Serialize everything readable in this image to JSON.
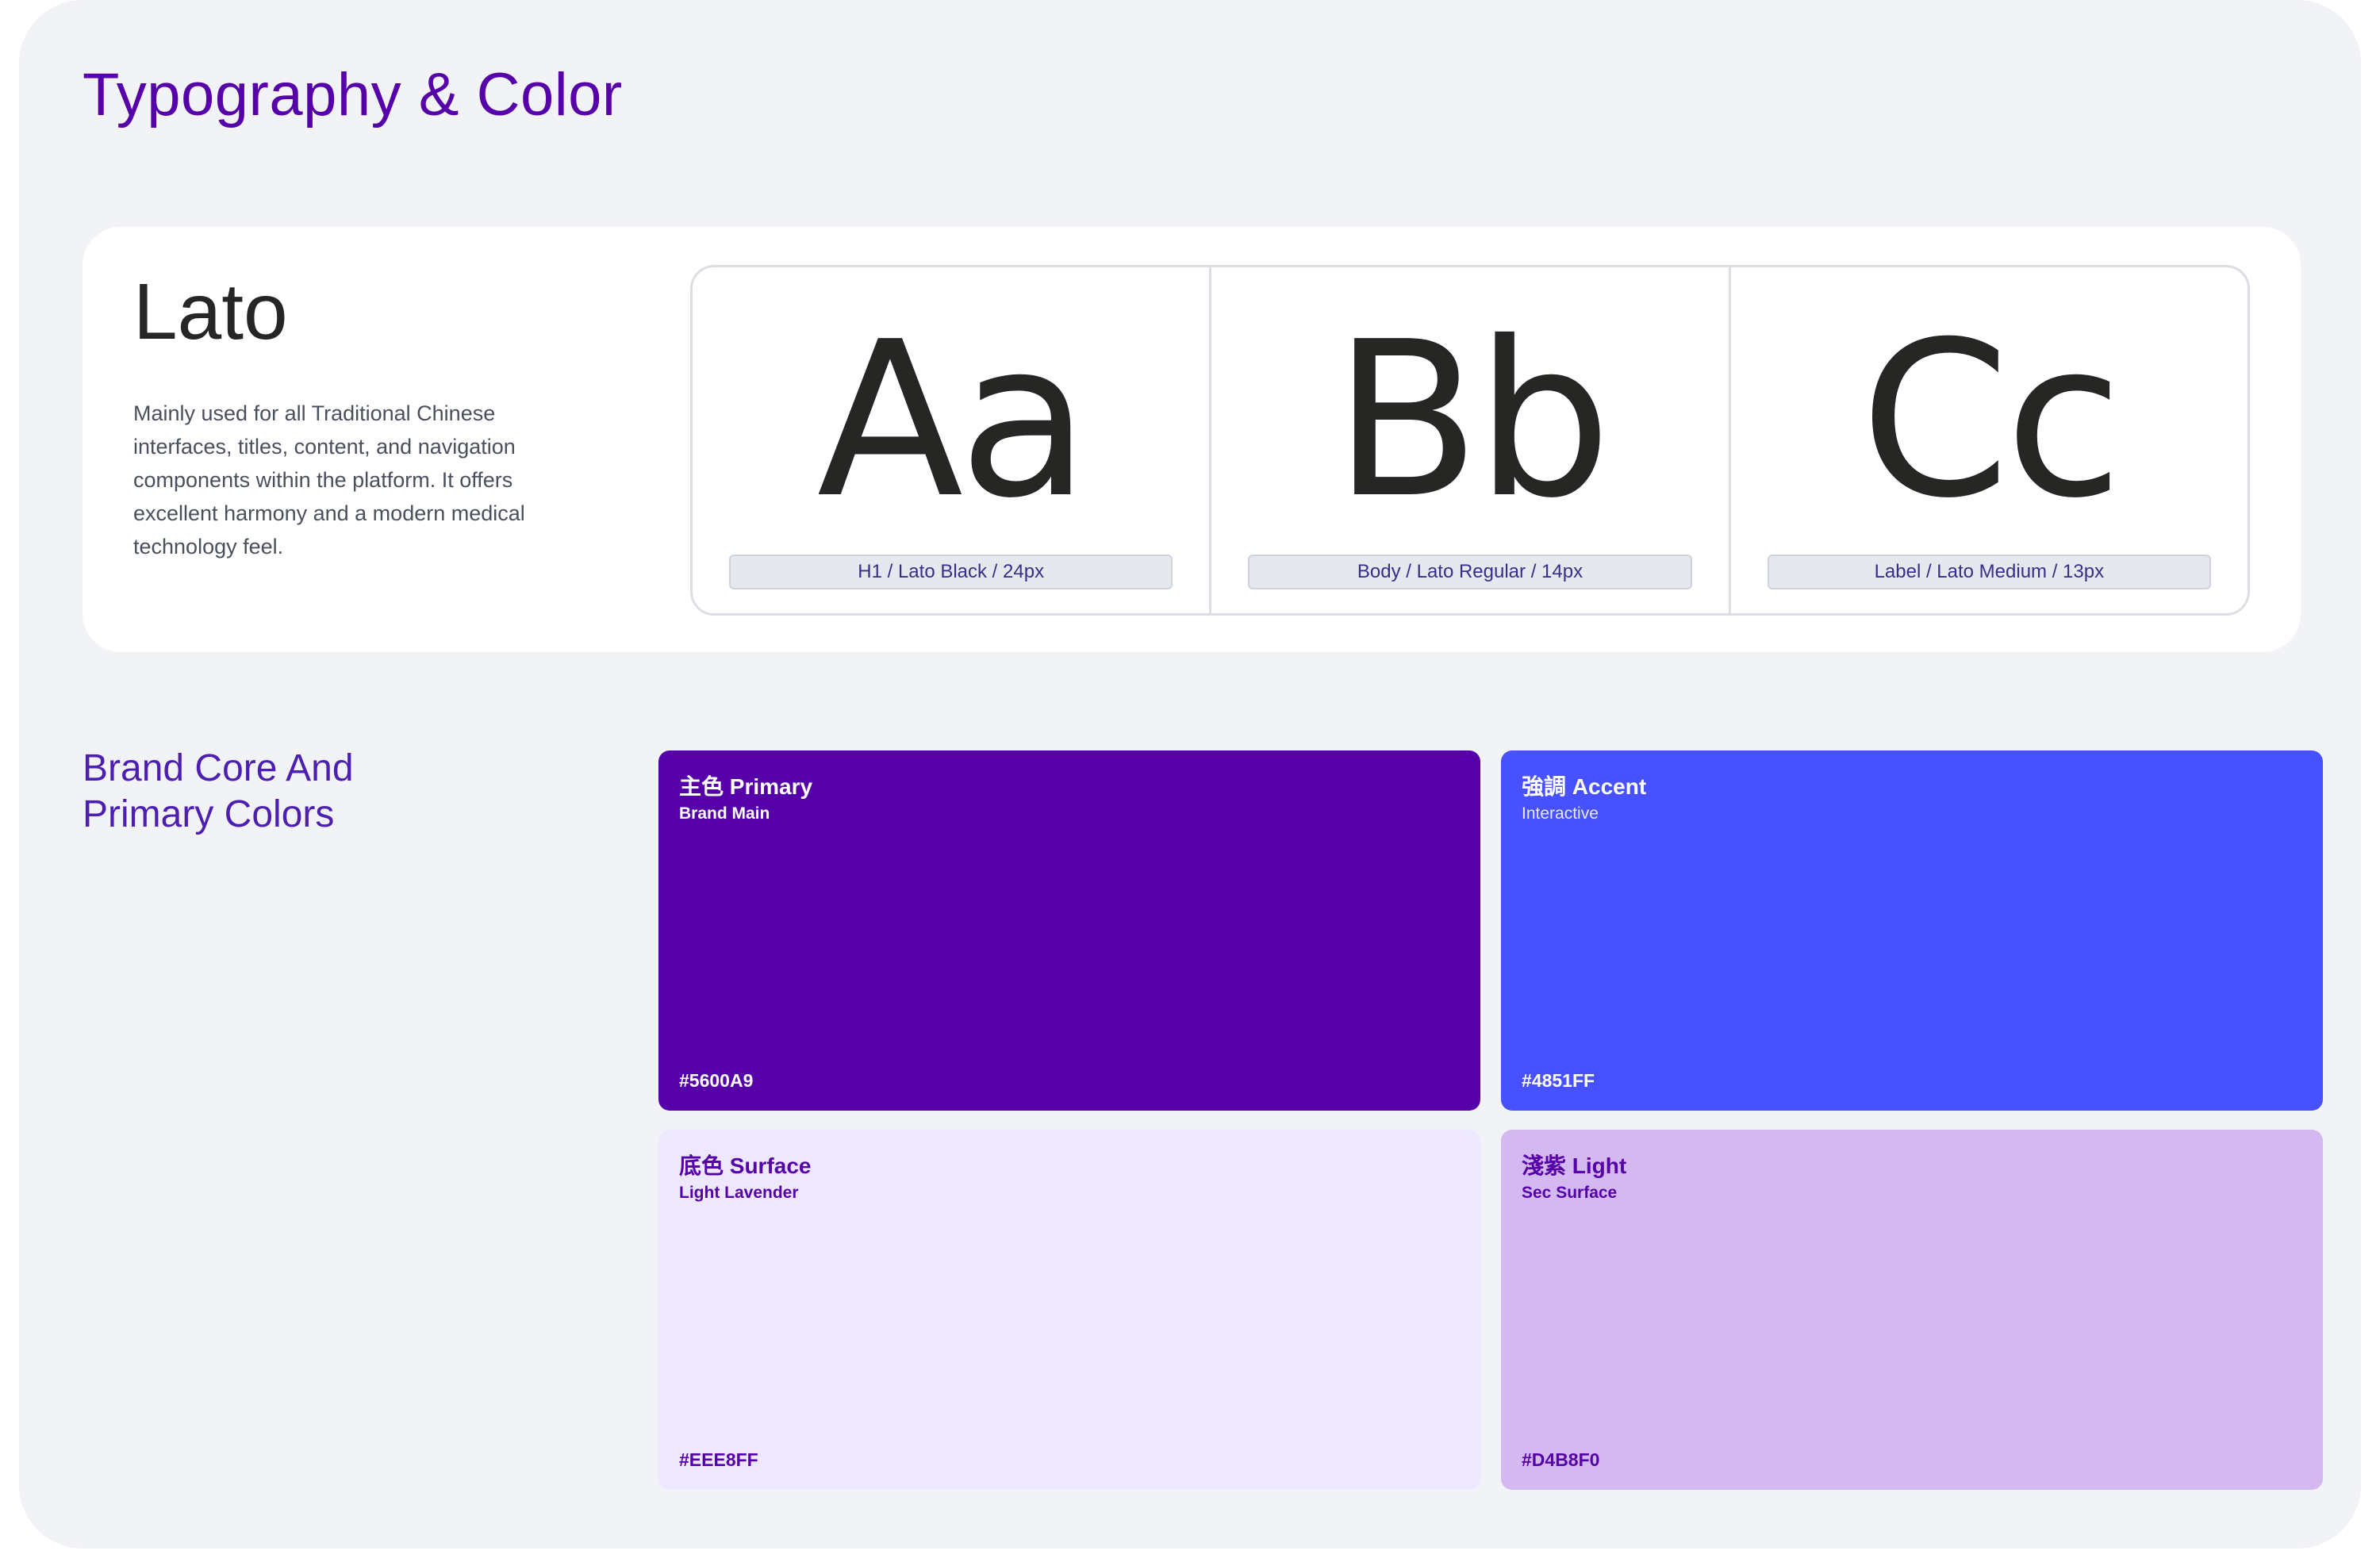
{
  "page": {
    "title": "Typography & Color"
  },
  "typography": {
    "font_name": "Lato",
    "description": "Mainly used for all Traditional Chinese interfaces, titles, content, and navigation components within the platform. It offers excellent harmony and a modern medical technology feel.",
    "samples": [
      {
        "glyph": "Aa",
        "spec": "H1 / Lato Black / 24px"
      },
      {
        "glyph": "Bb",
        "spec": "Body / Lato Regular / 14px"
      },
      {
        "glyph": "Cc",
        "spec": "Label / Lato Medium / 13px"
      }
    ]
  },
  "brand": {
    "title": "Brand Core And Primary Colors",
    "swatches": [
      {
        "name": "主色 Primary",
        "sub": "Brand Main",
        "hex": "#5600A9",
        "color": "#5600a9"
      },
      {
        "name": "強調 Accent",
        "sub": "Interactive",
        "hex": "#4851FF",
        "color": "#4851ff"
      },
      {
        "name": "底色 Surface",
        "sub": "Light Lavender",
        "hex": "#EEE8FF",
        "color": "#eee8ff"
      },
      {
        "name": "淺紫 Light",
        "sub": "Sec Surface",
        "hex": "#D4B8F0",
        "color": "#d4b8f0"
      }
    ]
  }
}
